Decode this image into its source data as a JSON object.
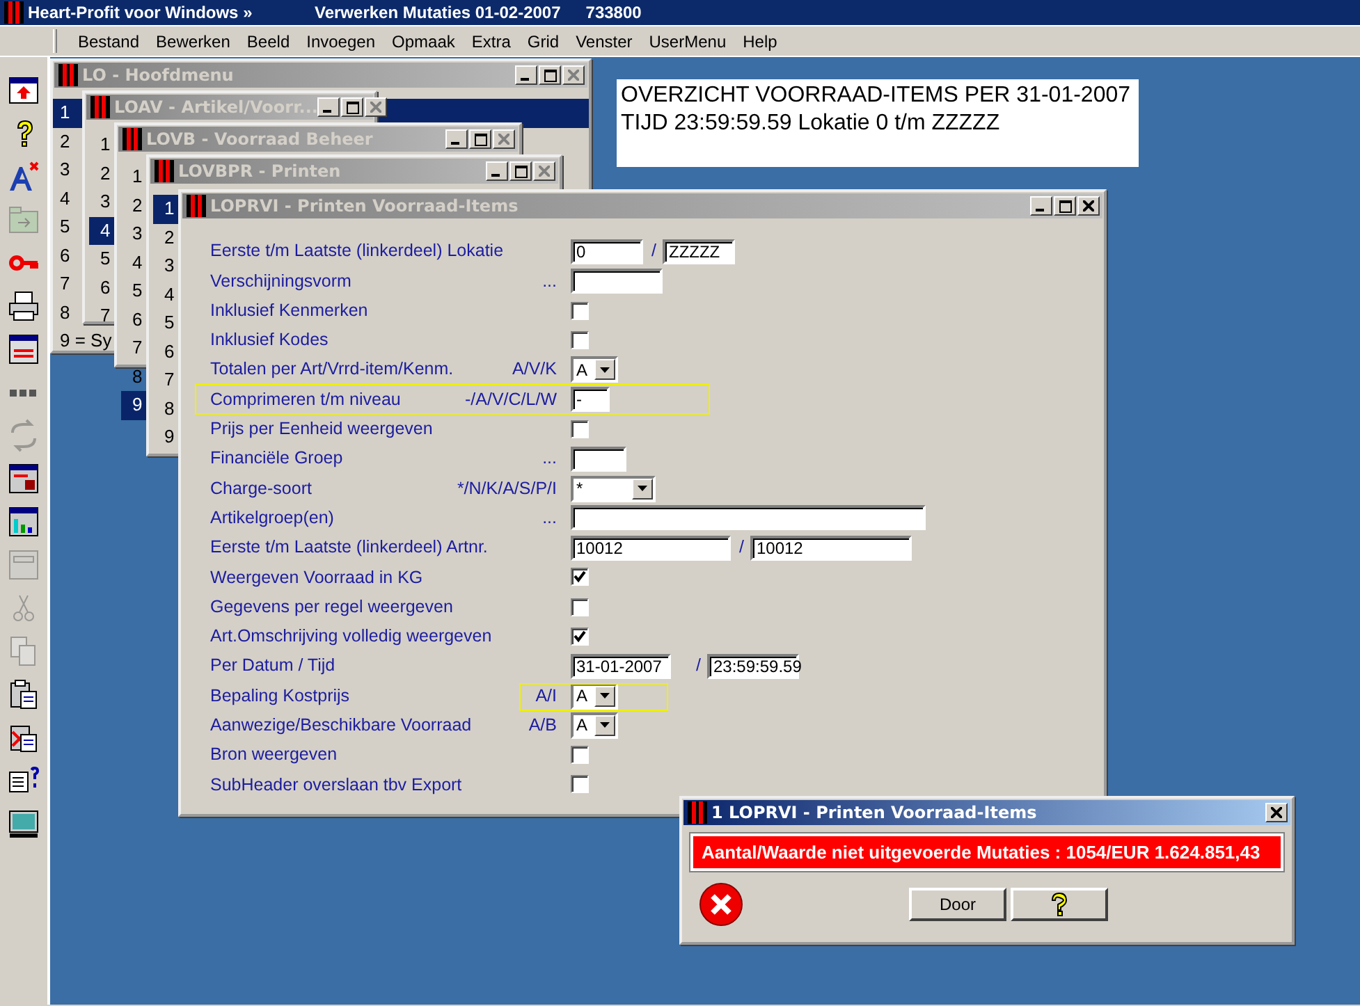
{
  "app": {
    "title": "Heart-Profit voor Windows  »",
    "context": "Verwerken Mutaties 01-02-2007",
    "code": "733800"
  },
  "menu": [
    "Bestand",
    "Bewerken",
    "Beeld",
    "Invoegen",
    "Opmaak",
    "Extra",
    "Grid",
    "Venster",
    "UserMenu",
    "Help"
  ],
  "toolbar": [
    {
      "kind": "exit-window",
      "disabled": false
    },
    {
      "kind": "help",
      "disabled": false
    },
    {
      "kind": "font-clear",
      "disabled": false
    },
    {
      "kind": "folder",
      "disabled": true
    },
    {
      "kind": "key",
      "disabled": false
    },
    {
      "kind": "printer",
      "disabled": false
    },
    {
      "kind": "window-red",
      "disabled": false
    },
    {
      "kind": "dots",
      "disabled": false
    },
    {
      "kind": "refresh",
      "disabled": true
    },
    {
      "kind": "window-lock",
      "disabled": false
    },
    {
      "kind": "window-chart",
      "disabled": false
    },
    {
      "kind": "window-plain",
      "disabled": true
    },
    {
      "kind": "scissors",
      "disabled": true
    },
    {
      "kind": "copy",
      "disabled": true
    },
    {
      "kind": "paste",
      "disabled": false
    },
    {
      "kind": "paste-red",
      "disabled": false
    },
    {
      "kind": "form-help",
      "disabled": false
    },
    {
      "kind": "monitor",
      "disabled": false
    }
  ],
  "report": {
    "lines": [
      "OVERZICHT VOORRAAD-ITEMS PER 31-01-2007",
      "TIJD 23:59:59.59 Lokatie 0 t/m ZZZZZ"
    ]
  },
  "windows": [
    {
      "title": "LO - Hoofdmenu",
      "items": [
        {
          "label": "1",
          "selected": true
        },
        {
          "label": "2",
          "selected": false
        },
        {
          "label": "3",
          "selected": false
        },
        {
          "label": "4",
          "selected": false
        },
        {
          "label": "5",
          "selected": false
        },
        {
          "label": "6",
          "selected": false
        },
        {
          "label": "7",
          "selected": false
        },
        {
          "label": "8",
          "selected": false
        },
        {
          "label": "9 = Sy",
          "selected": false
        }
      ]
    },
    {
      "title": "LOAV - Artikel/Voorr...",
      "items": [
        {
          "label": "1",
          "selected": false
        },
        {
          "label": "2",
          "selected": false
        },
        {
          "label": "3",
          "selected": false
        },
        {
          "label": "4",
          "selected": true
        },
        {
          "label": "5",
          "selected": false
        },
        {
          "label": "6",
          "selected": false
        },
        {
          "label": "7",
          "selected": false
        }
      ]
    },
    {
      "title": "LOVB - Voorraad Beheer",
      "items": [
        {
          "label": "1",
          "selected": false
        },
        {
          "label": "2",
          "selected": false
        },
        {
          "label": "3",
          "selected": false
        },
        {
          "label": "4",
          "selected": false
        },
        {
          "label": "5",
          "selected": false
        },
        {
          "label": "6",
          "selected": false
        },
        {
          "label": "7",
          "selected": false
        },
        {
          "label": "8",
          "selected": false
        },
        {
          "label": "9",
          "selected": true
        }
      ]
    },
    {
      "title": "LOVBPR - Printen",
      "items": [
        {
          "label": "1",
          "selected": true
        },
        {
          "label": "2",
          "selected": false
        },
        {
          "label": "3",
          "selected": false
        },
        {
          "label": "4",
          "selected": false
        },
        {
          "label": "5",
          "selected": false
        },
        {
          "label": "6",
          "selected": false
        },
        {
          "label": "7",
          "selected": false
        },
        {
          "label": "8",
          "selected": false
        },
        {
          "label": "9",
          "selected": false
        }
      ]
    }
  ],
  "form": {
    "title": "LOPRVI - Printen Voorraad-Items",
    "fields": [
      {
        "kind": "pair",
        "label": "Eerste t/m Laatste (linkerdeel) Lokatie",
        "value": "0",
        "separator": "/",
        "value2": "ZZZZZ"
      },
      {
        "kind": "text",
        "label": "Verschijningsvorm",
        "hint": "..."
      },
      {
        "kind": "checkbox",
        "label": "Inklusief Kenmerken",
        "checked": false
      },
      {
        "kind": "checkbox",
        "label": "Inklusief Kodes",
        "checked": false
      },
      {
        "kind": "select",
        "label": "Totalen per Art/Vrrd-item/Kenm.",
        "hint": "A/V/K",
        "value": "A"
      },
      {
        "kind": "text",
        "label": "Comprimeren t/m niveau",
        "hint": "-/A/V/C/L/W",
        "value": "-",
        "focused": true
      },
      {
        "kind": "checkbox",
        "label": "Prijs per Eenheid weergeven",
        "checked": false
      },
      {
        "kind": "text",
        "label": "Financiële Groep",
        "hint": "..."
      },
      {
        "kind": "select",
        "label": "Charge-soort",
        "hint": "*/N/K/A/S/P/I",
        "value": "*"
      },
      {
        "kind": "text",
        "label": "Artikelgroep(en)",
        "hint": "..."
      },
      {
        "kind": "pair",
        "label": "Eerste t/m Laatste (linkerdeel) Artnr.",
        "value": "10012",
        "separator": "/",
        "value2": "10012"
      },
      {
        "kind": "checkbox",
        "label": "Weergeven Voorraad in KG",
        "checked": true
      },
      {
        "kind": "checkbox",
        "label": "Gegevens per regel weergeven",
        "checked": false
      },
      {
        "kind": "checkbox",
        "label": "Art.Omschrijving volledig weergeven",
        "checked": true
      },
      {
        "kind": "pair",
        "label": "Per Datum / Tijd",
        "value": "31-01-2007",
        "separator": "/",
        "value2": "23:59:59.59"
      },
      {
        "kind": "select",
        "label": "Bepaling Kostprijs",
        "hint": "A/I",
        "value": "A",
        "focused": true
      },
      {
        "kind": "select",
        "label": "Aanwezige/Beschikbare Voorraad",
        "hint": "A/B",
        "value": "A"
      },
      {
        "kind": "checkbox",
        "label": "Bron weergeven",
        "checked": false
      },
      {
        "kind": "checkbox",
        "label": "SubHeader overslaan tbv Export",
        "checked": false
      }
    ]
  },
  "dialog": {
    "title": "1 LOPRVI - Printen Voorraad-Items",
    "message": "Aantal/Waarde niet uitgevoerde Mutaties : 1054/EUR 1.624.851,43",
    "buttons": [
      {
        "kind": "text",
        "label": "Door"
      },
      {
        "kind": "help"
      }
    ]
  }
}
